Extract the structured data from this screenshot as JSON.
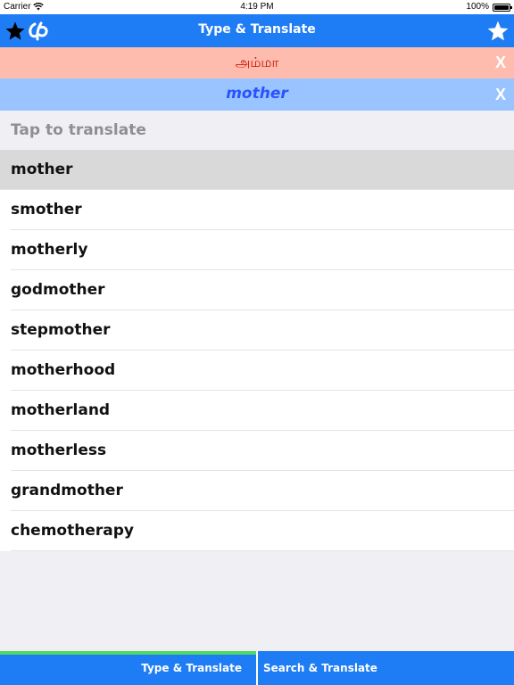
{
  "status_bar": {
    "carrier": "Carrier",
    "time": "4:19 PM",
    "battery": "100%"
  },
  "nav": {
    "title": "Type & Translate",
    "left_icons": [
      "star-icon",
      "app-logo-icon"
    ],
    "right_icon": "star-icon"
  },
  "source": {
    "text": "அம்மா",
    "close": "X"
  },
  "target": {
    "text": "mother",
    "close": "X"
  },
  "input": {
    "placeholder": "Tap to translate",
    "value": ""
  },
  "suggestions": [
    "mother",
    "smother",
    "motherly",
    "godmother",
    "stepmother",
    "motherhood",
    "motherland",
    "motherless",
    "grandmother",
    "chemotherapy"
  ],
  "tabs": {
    "type_translate": "Type & Translate",
    "search_translate": "Search & Translate"
  },
  "colors": {
    "nav_blue": "#1e7cf4",
    "source_bg": "#fdbcae",
    "source_text": "#cc1100",
    "target_bg": "#99c4ff",
    "target_text": "#2b52ff",
    "active_tab_indicator": "#4cd964"
  }
}
